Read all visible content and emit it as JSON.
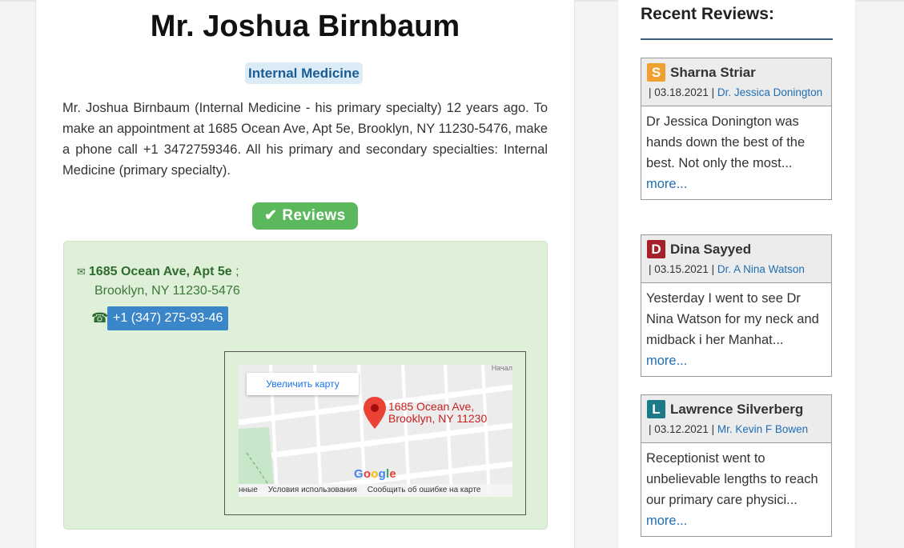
{
  "doctor": {
    "name": "Mr. Joshua Birnbaum",
    "specialty_badge": "Internal Medicine",
    "description": "Mr. Joshua Birnbaum (Internal Medicine - his primary specialty) 12 years ago. To make an appointment at 1685 Ocean Ave, Apt 5e, Brooklyn, NY 11230-5476, make a phone call +1 3472759346. All his primary and secondary specialties: Internal Medicine (primary specialty)."
  },
  "reviews_button": "✔ Reviews",
  "contact": {
    "street": "1685 Ocean Ave, Apt 5e",
    "separator": " ;",
    "city_line": "Brooklyn, NY 11230-5476",
    "phone": "+1 (347) 275-93-46"
  },
  "map": {
    "enlarge_button": "Увеличить карту",
    "pin_label_line1": "1685 Ocean Ave,",
    "pin_label_line2": "Brooklyn, NY 11230",
    "footer_data": "нные",
    "footer_terms": "Условия использования",
    "footer_report": "Сообщить об ошибке на карте",
    "corner_text": "Начал",
    "logo_text": "Google"
  },
  "sidebar": {
    "title": "Recent Reviews:",
    "reviews": [
      {
        "letter": "S",
        "letter_color": "#f0a030",
        "reviewer": "Sharna Striar",
        "date": "| 03.18.2021 |",
        "doctor": "Dr. Jessica Donington",
        "excerpt": "Dr Jessica Donington was hands down the best of the best. Not only the most...",
        "more": "more..."
      },
      {
        "letter": "D",
        "letter_color": "#a5202a",
        "reviewer": "Dina Sayyed",
        "date": "| 03.15.2021 |",
        "doctor": "Dr. A Nina Watson",
        "excerpt": "Yesterday I went to see Dr Nina Watson for my neck and midback i her Manhat...",
        "more": "more..."
      },
      {
        "letter": "L",
        "letter_color": "#1c7a86",
        "reviewer": "Lawrence Silverberg",
        "date": "| 03.12.2021 |",
        "doctor": "Mr. Kevin F Bowen",
        "excerpt": "Receptionist went to unbelievable lengths to reach our primary care physici...",
        "more": "more..."
      }
    ]
  }
}
